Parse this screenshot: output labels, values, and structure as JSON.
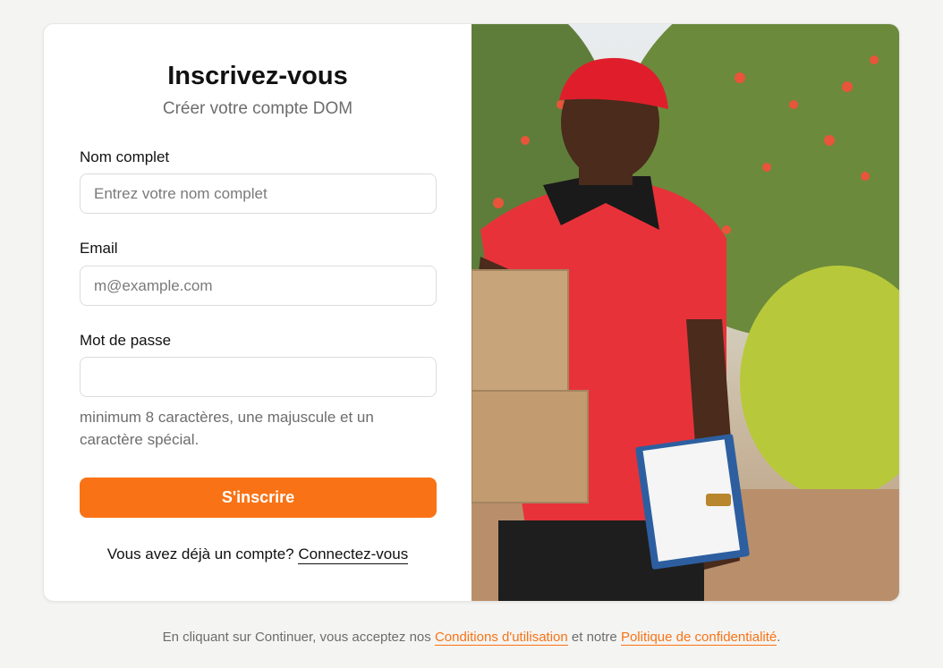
{
  "form": {
    "title": "Inscrivez-vous",
    "subtitle": "Créer votre compte DOM",
    "name_label": "Nom complet",
    "name_placeholder": "Entrez votre nom complet",
    "email_label": "Email",
    "email_placeholder": "m@example.com",
    "password_label": "Mot de passe",
    "password_value": "",
    "password_hint": "minimum 8 caractères, une majuscule et un caractère spécial.",
    "submit_label": "S'inscrire",
    "login_prompt": "Vous avez déjà un compte?",
    "login_link": "Connectez-vous"
  },
  "footer": {
    "text_before": "En cliquant sur Continuer, vous acceptez nos",
    "terms_link": "Conditions d'utilisation",
    "text_middle": "et notre",
    "privacy_link": "Politique de confidentialité",
    "text_after": "."
  },
  "colors": {
    "accent": "#f97316",
    "background": "#f4f4f2",
    "card": "#ffffff"
  },
  "photo": {
    "icon": "delivery-person-photo"
  }
}
